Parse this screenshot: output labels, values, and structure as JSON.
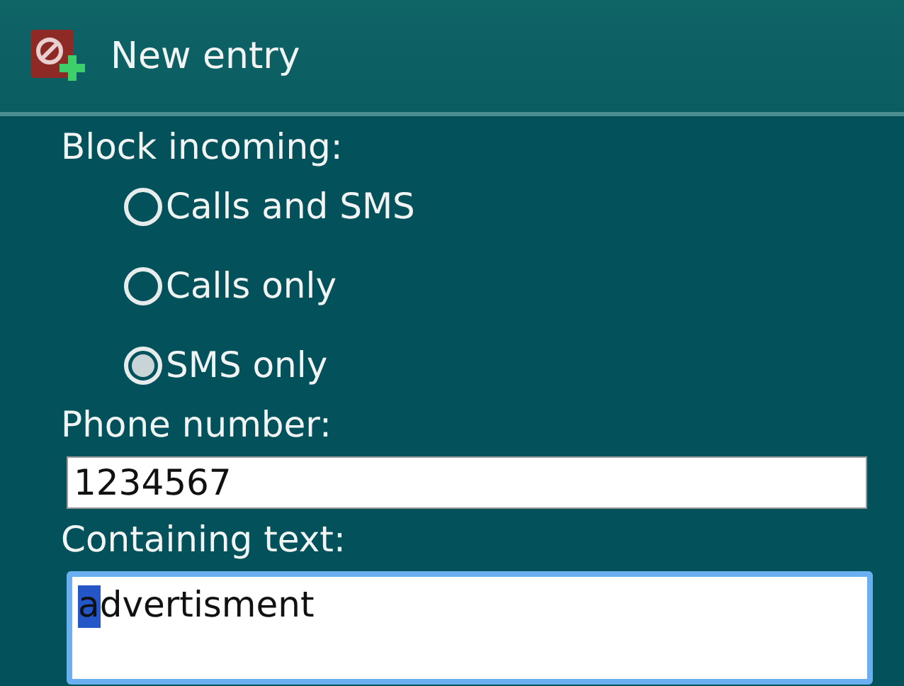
{
  "window": {
    "title": "New entry"
  },
  "block_incoming": {
    "label": "Block incoming:",
    "options": [
      {
        "label": "Calls and SMS",
        "selected": false
      },
      {
        "label": "Calls only",
        "selected": false
      },
      {
        "label": "SMS only",
        "selected": true
      }
    ]
  },
  "fields": [
    {
      "label": "Phone number:",
      "value": "1234567",
      "focused": false
    },
    {
      "label": "Containing text:",
      "value": "advertisment",
      "focused": true
    }
  ]
}
